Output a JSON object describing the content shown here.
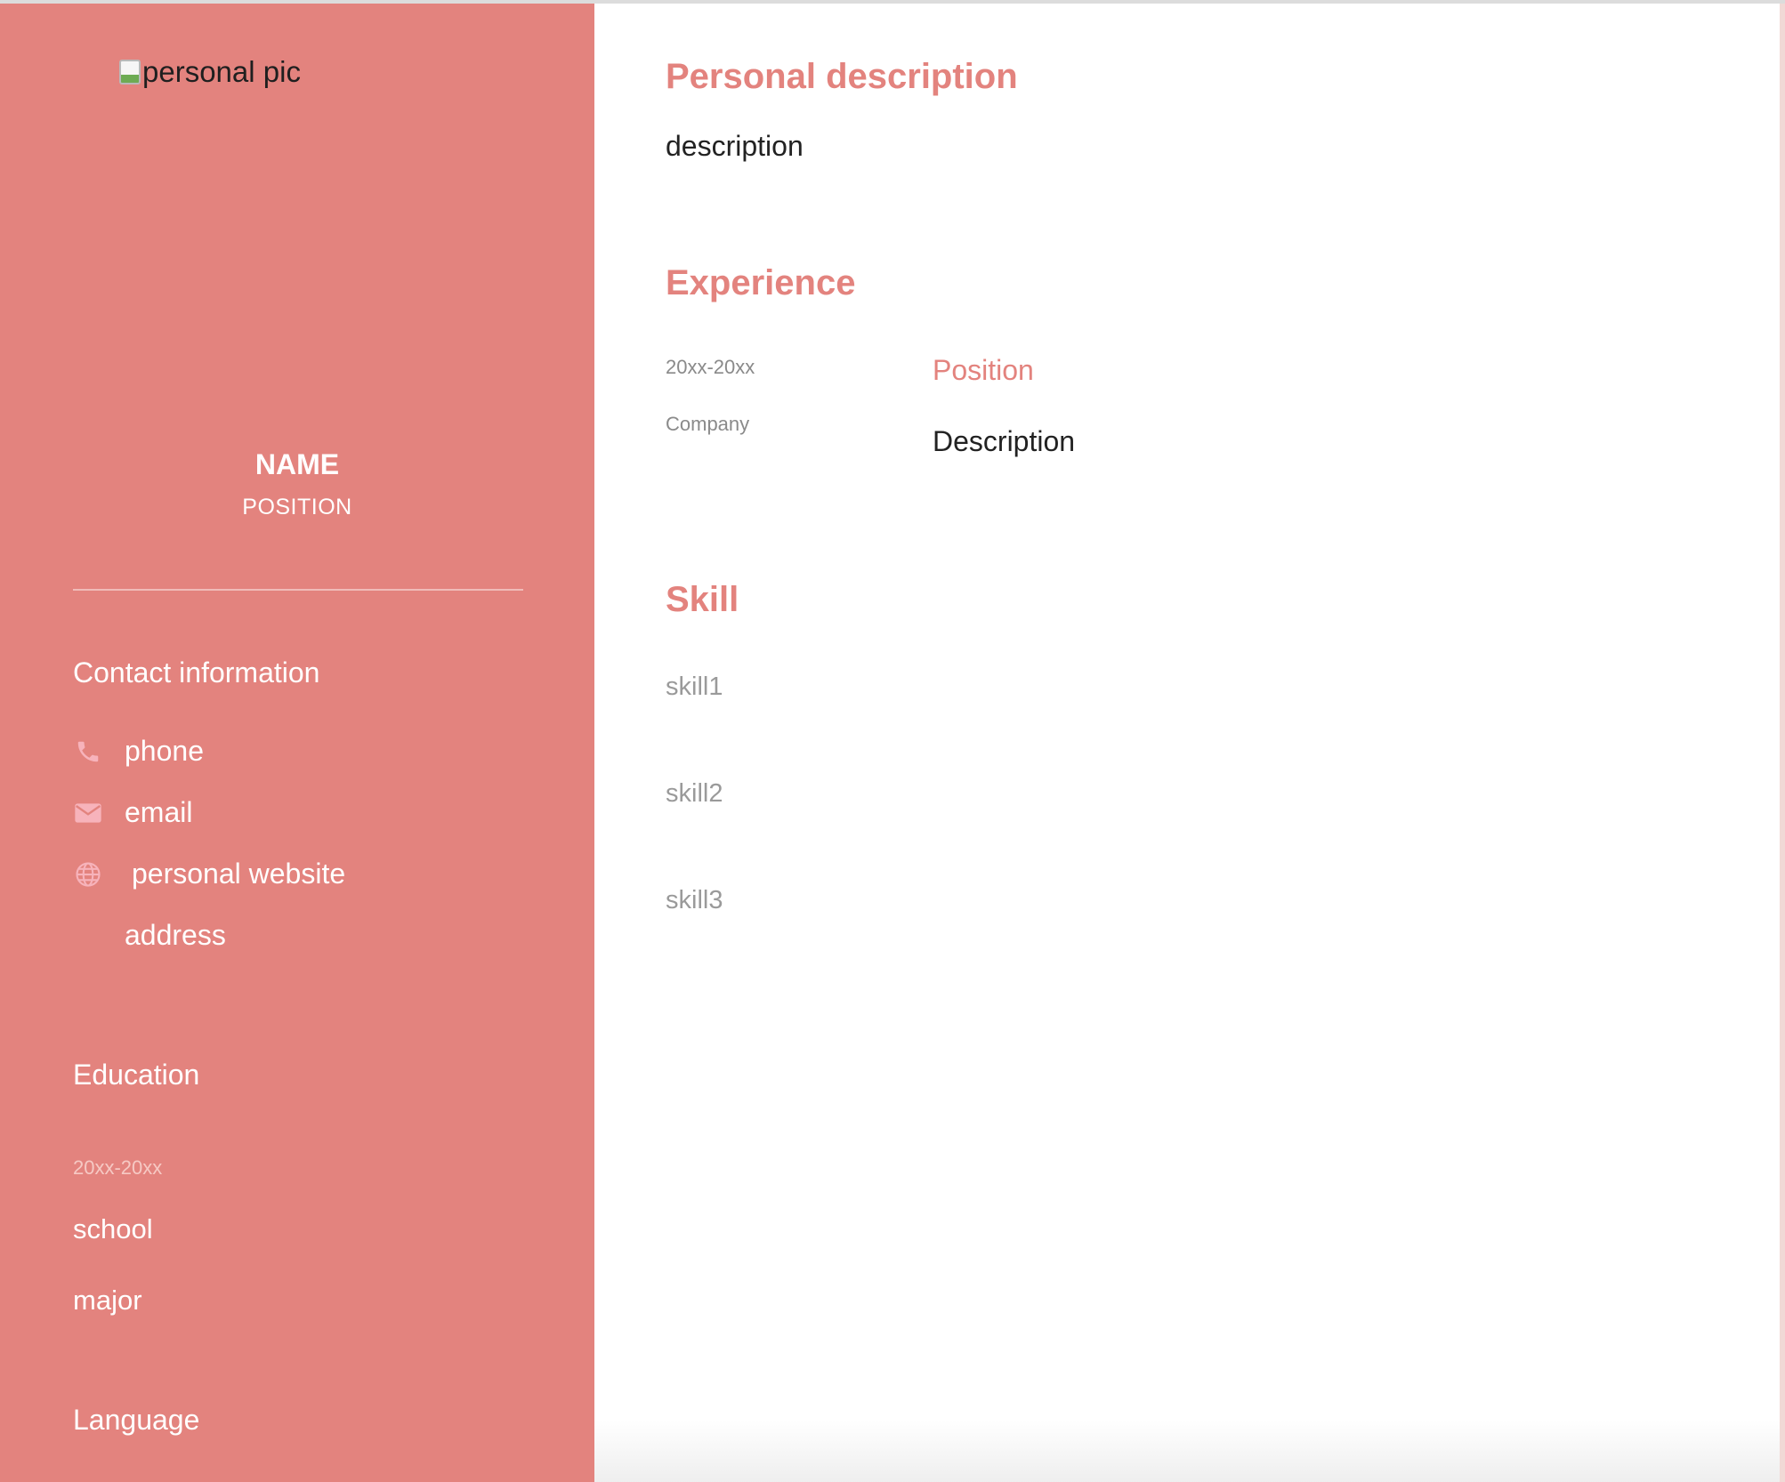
{
  "sidebar": {
    "photo_alt": "personal pic",
    "name": "NAME",
    "position": "POSITION",
    "contact": {
      "heading": "Contact information",
      "items": [
        {
          "icon": "phone-icon",
          "text": "phone"
        },
        {
          "icon": "email-icon",
          "text": "email"
        },
        {
          "icon": "globe-icon",
          "text": "personal website"
        },
        {
          "icon": "",
          "text": "address"
        }
      ]
    },
    "education": {
      "heading": "Education",
      "date": "20xx-20xx",
      "school": "school",
      "major": "major"
    },
    "language": {
      "heading": "Language"
    }
  },
  "main": {
    "personal_description": {
      "heading": "Personal description",
      "text": "description"
    },
    "experience": {
      "heading": "Experience",
      "date": "20xx-20xx",
      "company": "Company",
      "position": "Position",
      "description": "Description"
    },
    "skill": {
      "heading": "Skill",
      "items": [
        "skill1",
        "skill2",
        "skill3"
      ]
    }
  },
  "colors": {
    "accent": "#e3837e",
    "sidebar_text": "#ffffff",
    "icon": "#f7b3bb",
    "muted": "#9a9a9a"
  }
}
